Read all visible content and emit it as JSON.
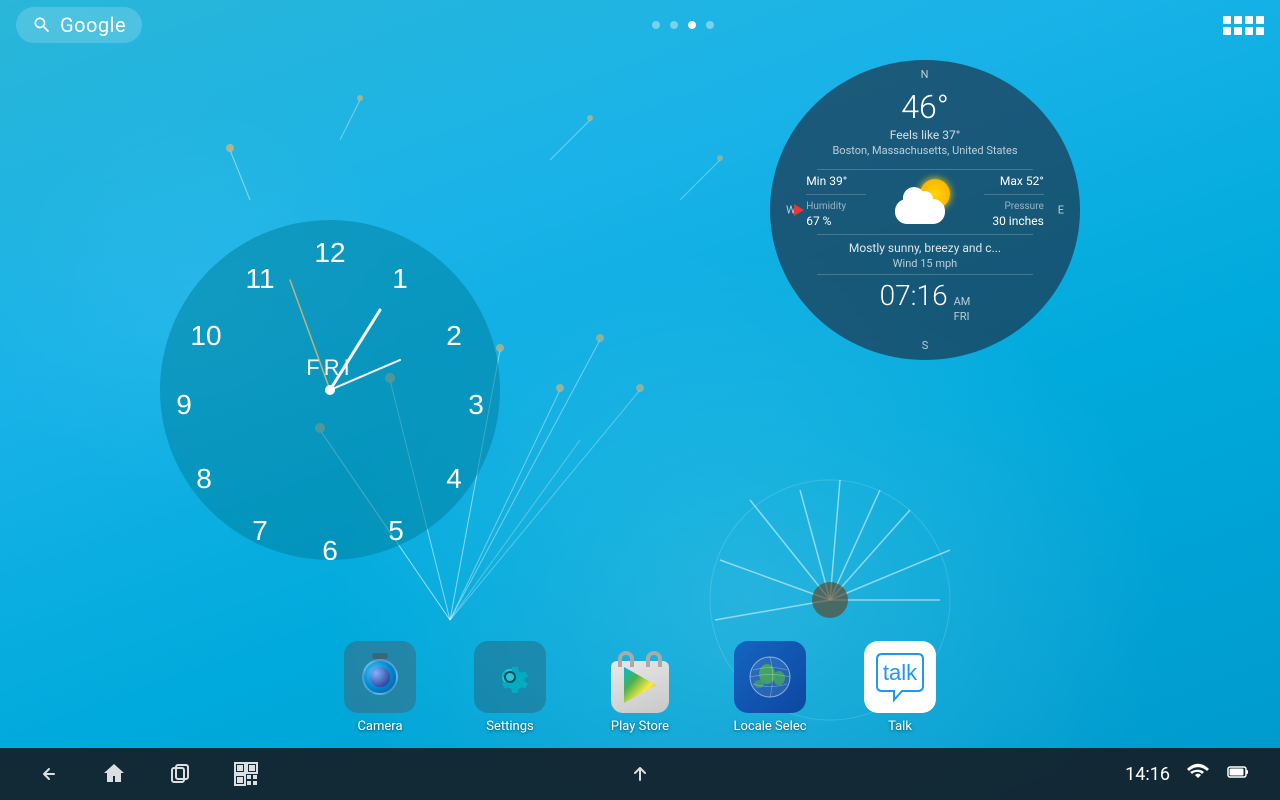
{
  "background": {
    "color_top": "#29b6d8",
    "color_bottom": "#0099cc"
  },
  "top_bar": {
    "search_label": "Google",
    "apps_grid_label": "All Apps"
  },
  "page_dots": [
    {
      "active": false,
      "index": 0
    },
    {
      "active": false,
      "index": 1
    },
    {
      "active": true,
      "index": 2
    },
    {
      "active": false,
      "index": 3
    }
  ],
  "clock": {
    "day": "FRI",
    "numbers": [
      "12",
      "1",
      "2",
      "3",
      "4",
      "5",
      "6",
      "7",
      "8",
      "9",
      "10",
      "11"
    ]
  },
  "weather": {
    "temperature": "46°",
    "feels_like": "Feels like 37°",
    "location": "Boston, Massachusetts, United States",
    "min_temp": "Min 39°",
    "max_temp": "Max 52°",
    "humidity_label": "Humidity",
    "humidity_val": "67 %",
    "pressure_label": "Pressure",
    "pressure_val": "30 inches",
    "description": "Mostly sunny, breezy and c...",
    "wind": "Wind  15  mph",
    "time": "07:16",
    "ampm": "AM",
    "day": "FRI",
    "compass": {
      "n": "N",
      "s": "S",
      "w": "W",
      "e": "E"
    }
  },
  "dock": [
    {
      "id": "camera",
      "label": "Camera",
      "type": "camera"
    },
    {
      "id": "settings",
      "label": "Settings",
      "type": "settings"
    },
    {
      "id": "play-store",
      "label": "Play Store",
      "type": "play-store"
    },
    {
      "id": "locale-select",
      "label": "Locale Selec",
      "type": "globe"
    },
    {
      "id": "talk",
      "label": "Talk",
      "type": "talk"
    }
  ],
  "nav_bar": {
    "back_label": "Back",
    "home_label": "Home",
    "recents_label": "Recent Apps",
    "qr_label": "QR Scanner",
    "up_label": "Up",
    "time": "14:16",
    "wifi": true,
    "battery": true
  }
}
